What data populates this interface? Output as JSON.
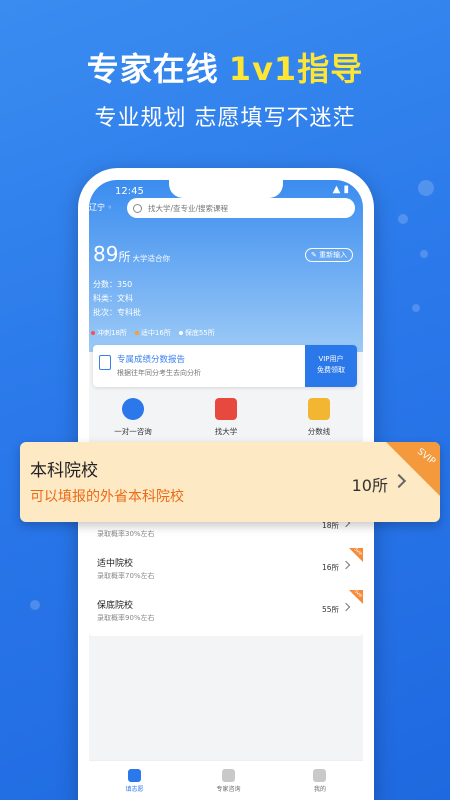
{
  "promo": {
    "headline_white": "专家在线",
    "headline_yellow": "1v1指导",
    "subline": "专业规划 志愿填写不迷茫"
  },
  "status": {
    "time": "12:45",
    "icons": "▲ ▮"
  },
  "app": {
    "region": "辽宁",
    "search_placeholder": "找大学/查专业/搜索课程",
    "count_number": "89",
    "count_unit": "所",
    "count_text": "大学适合你",
    "reinput_label": "重新输入",
    "score": "分数：350",
    "subject": "科类：文科",
    "batch": "批次：专科批",
    "levels": [
      {
        "label": "冲刺18所",
        "color": "#ff4d4f"
      },
      {
        "label": "适中16所",
        "color": "#ff9c2a"
      },
      {
        "label": "保底55所",
        "color": "#ffffff"
      }
    ],
    "report": {
      "title": "专属成绩分数报告",
      "subtitle": "根据往年同分考生去向分析",
      "vip_line1": "VIP用户",
      "vip_line2": "免费领取"
    },
    "quick": [
      {
        "label": "一对一咨询"
      },
      {
        "label": "找大学"
      },
      {
        "label": "分数线"
      }
    ],
    "rows": [
      {
        "name": "",
        "prob": "录取概率30%左右",
        "count": "18所"
      },
      {
        "name": "适中院校",
        "prob": "录取概率70%左右",
        "count": "16所"
      },
      {
        "name": "保底院校",
        "prob": "录取概率90%左右",
        "count": "55所"
      }
    ],
    "row_badge": "SVIP",
    "tabs": [
      {
        "label": "填志愿"
      },
      {
        "label": "专家咨询"
      },
      {
        "label": "我的"
      }
    ]
  },
  "overlay": {
    "name": "本科院校",
    "subtitle": "可以填报的外省本科院校",
    "count": "10所",
    "badge": "SVIP"
  }
}
